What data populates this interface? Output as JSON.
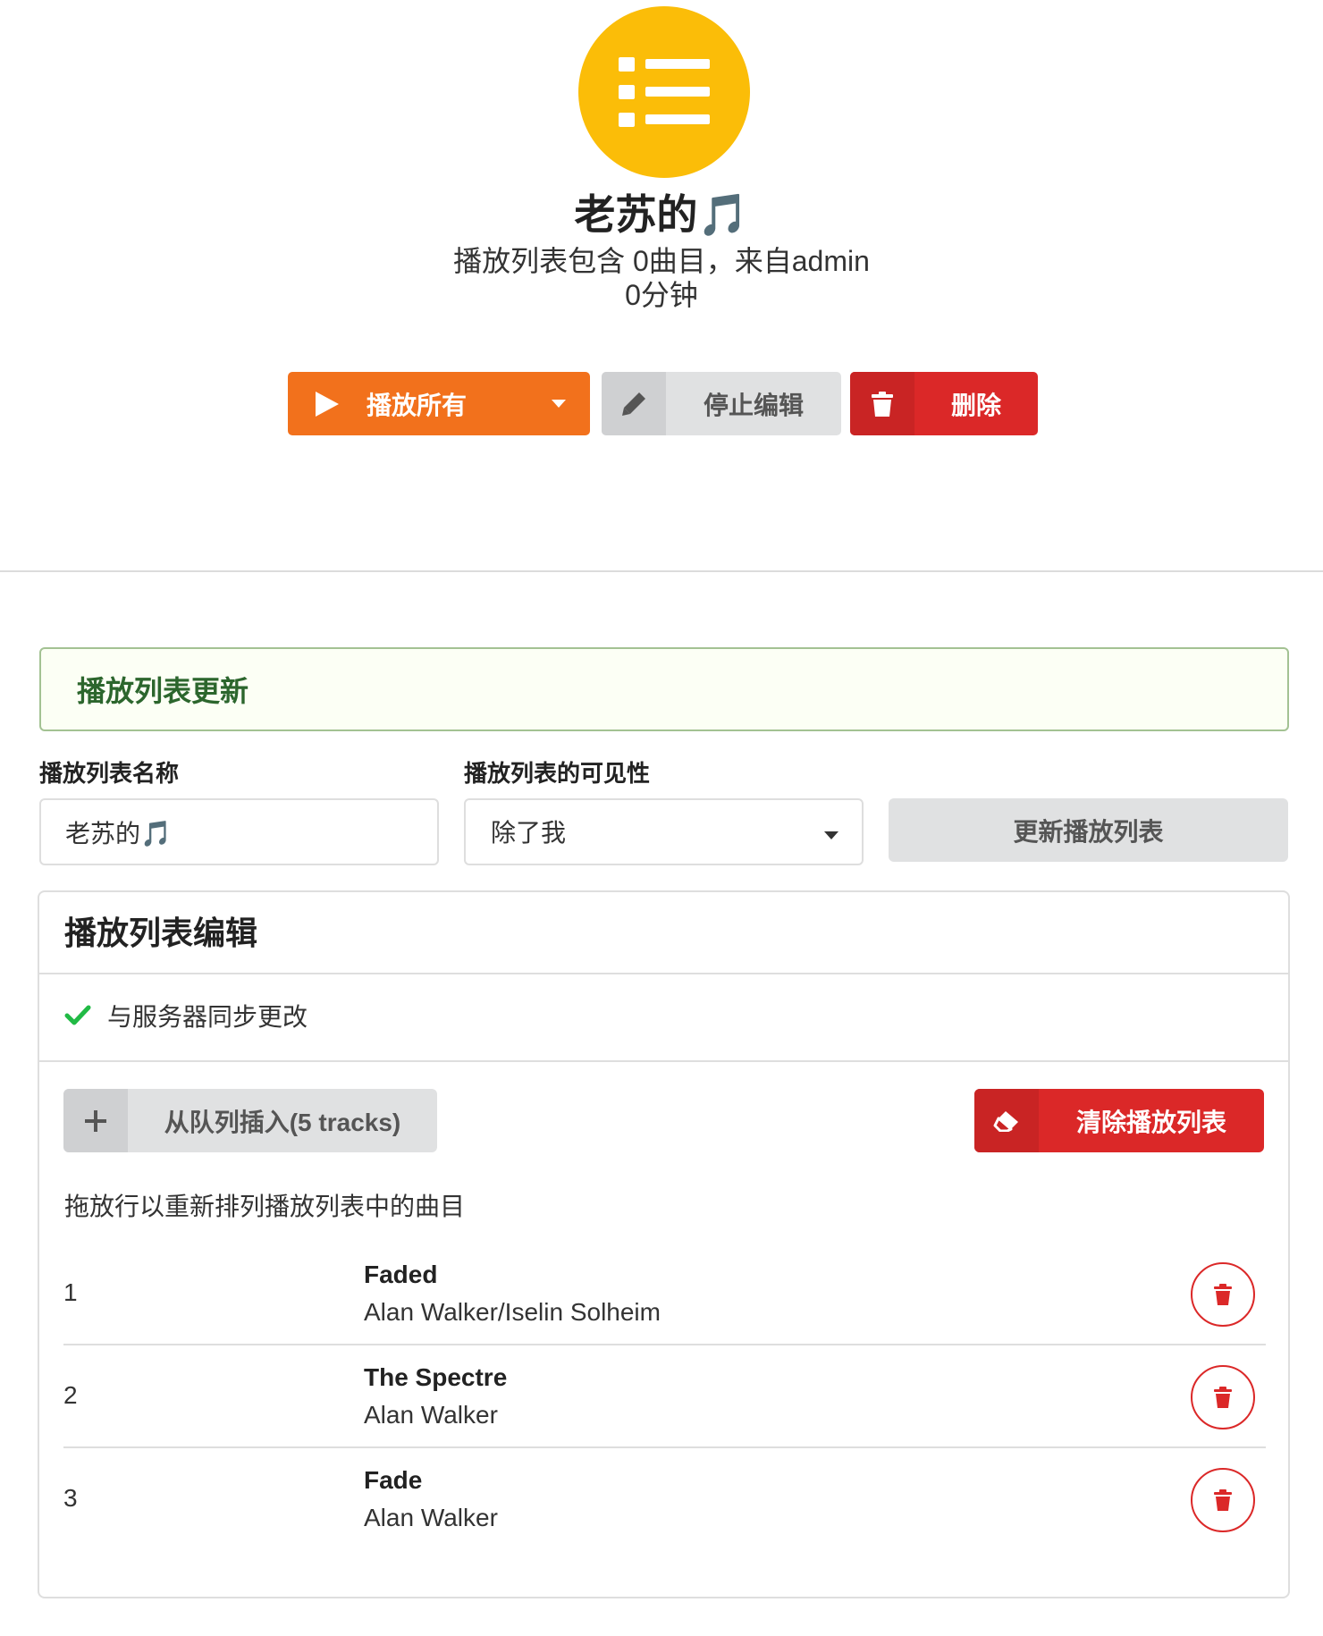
{
  "header": {
    "icon": "list-icon",
    "accent_color": "#fbbd08",
    "title": "老苏的🎵",
    "subtitle": "播放列表包含 0曲目，来自admin",
    "duration": "0分钟"
  },
  "actions": {
    "play_all_label": "播放所有",
    "play_all_color": "#f2711c",
    "stop_edit_label": "停止编辑",
    "delete_label": "删除",
    "delete_color": "#db2828"
  },
  "update": {
    "message": "播放列表更新",
    "name_label": "播放列表名称",
    "name_value": "老苏的🎵",
    "visibility_label": "播放列表的可见性",
    "visibility_value": "除了我",
    "update_button_label": "更新播放列表"
  },
  "edit": {
    "header": "播放列表编辑",
    "sync_status": "与服务器同步更改",
    "insert_label": "从队列插入(5 tracks)",
    "clear_label": "清除播放列表",
    "drag_hint": "拖放行以重新排列播放列表中的曲目",
    "tracks": [
      {
        "num": "1",
        "title": "Faded",
        "artist": "Alan Walker/Iselin Solheim"
      },
      {
        "num": "2",
        "title": "The Spectre",
        "artist": "Alan Walker"
      },
      {
        "num": "3",
        "title": "Fade",
        "artist": "Alan Walker"
      }
    ]
  }
}
